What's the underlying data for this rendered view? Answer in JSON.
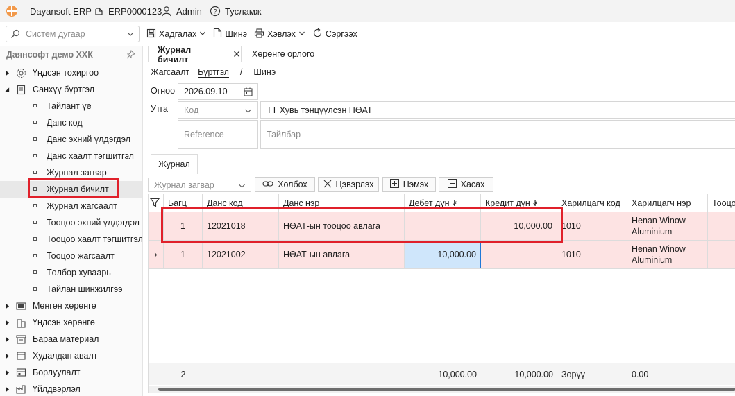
{
  "titlebar": {
    "app_name": "Dayansoft ERP",
    "doc_no": "ERP0000123",
    "user": "Admin",
    "help": "Тусламж"
  },
  "toolbar": {
    "search_placeholder": "Систем дугаар",
    "save": "Хадгалах",
    "new": "Шинэ",
    "print": "Хэвлэх",
    "refresh": "Сэргээх"
  },
  "sidebar": {
    "company": "Даянсофт демо ХХК",
    "items": [
      {
        "label": "Үндсэн тохиргоо",
        "level": 0,
        "icon": "gear-icon"
      },
      {
        "label": "Санхүү бүртгэл",
        "level": 0,
        "icon": "document-icon",
        "expanded": true
      },
      {
        "label": "Тайлант үе",
        "level": 1
      },
      {
        "label": "Данс код",
        "level": 1
      },
      {
        "label": "Данс эхний үлдэгдэл",
        "level": 1
      },
      {
        "label": "Данс хаалт тэгшитгэл",
        "level": 1
      },
      {
        "label": "Журнал загвар",
        "level": 1
      },
      {
        "label": "Журнал бичилт",
        "level": 1,
        "active": true
      },
      {
        "label": "Журнал жагсаалт",
        "level": 1
      },
      {
        "label": "Тооцоо эхний үлдэгдэл",
        "level": 1
      },
      {
        "label": "Тооцоо хаалт тэгшитгэл",
        "level": 1
      },
      {
        "label": "Тооцоо жагсаалт",
        "level": 1
      },
      {
        "label": "Төлбөр хуваарь",
        "level": 1
      },
      {
        "label": "Тайлан шинжилгээ",
        "level": 1
      },
      {
        "label": "Мөнгөн хөрөнгө",
        "level": 0,
        "icon": "money-icon"
      },
      {
        "label": "Үндсэн хөрөнгө",
        "level": 0,
        "icon": "building-icon"
      },
      {
        "label": "Бараа материал",
        "level": 0,
        "icon": "box-icon"
      },
      {
        "label": "Худалдан авалт",
        "level": 0,
        "icon": "cart-icon"
      },
      {
        "label": "Борлуулалт",
        "level": 0,
        "icon": "sales-icon"
      },
      {
        "label": "Үйлдвэрлэл",
        "level": 0,
        "icon": "factory-icon"
      }
    ]
  },
  "tabs": [
    {
      "label": "Журнал бичилт",
      "active": true
    },
    {
      "label": "Хөрөнгө орлого",
      "active": false
    }
  ],
  "subnav": {
    "list": "Жагсаалт",
    "register": "Бүртгэл",
    "sep": "/",
    "new": "Шинэ"
  },
  "form": {
    "date_label": "Огноо",
    "date_value": "2026.09.10",
    "text_label": "Утга",
    "code_placeholder": "Код",
    "text_value": "ТТ Хувь тэнцүүлсэн НӨАТ",
    "reference_placeholder": "Reference",
    "description_placeholder": "Тайлбар"
  },
  "detail_tab": "Журнал",
  "grid_toolbar": {
    "template_placeholder": "Журнал загвар",
    "link": "Холбох",
    "clear": "Цэвэрлэх",
    "add": "Нэмэх",
    "delete": "Хасах"
  },
  "grid": {
    "columns": [
      "",
      "Багц",
      "Данс код",
      "Данс нэр",
      "Дебет дүн ₮",
      "Кредит дүн ₮",
      "Харилцагч код",
      "Харилцагч нэр",
      "Тооцоо"
    ],
    "rows": [
      {
        "indicator": "",
        "batch": "1",
        "account_code": "12021018",
        "account_name": "НӨАТ-ын тооцоо авлага",
        "debit": "",
        "credit": "10,000.00",
        "partner_code": "1010",
        "partner_name": [
          "Henan Winow",
          "Aluminium"
        ]
      },
      {
        "indicator": "›",
        "batch": "1",
        "account_code": "12021002",
        "account_name": "НӨАТ-ын авлага",
        "debit": "10,000.00",
        "credit": "",
        "partner_code": "1010",
        "partner_name": [
          "Henan Winow",
          "Aluminium"
        ]
      }
    ],
    "footer": {
      "count": "2",
      "debit": "10,000.00",
      "credit": "10,000.00",
      "diff_label": "Зөрүү",
      "diff": "0.00"
    }
  },
  "colors": {
    "row_error": "#fde3e3",
    "highlight": "#e0202a",
    "selected": "#cfe6fb"
  }
}
